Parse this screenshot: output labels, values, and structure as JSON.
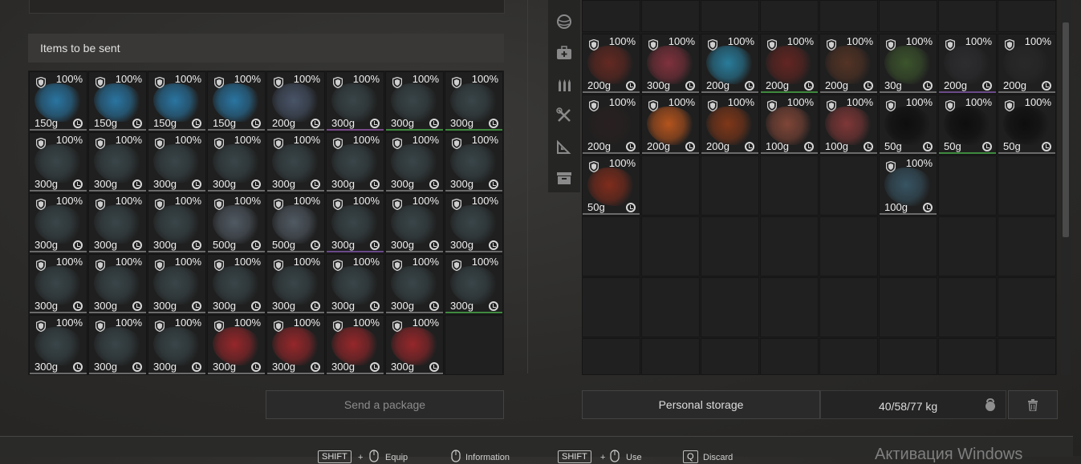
{
  "panels": {
    "send_header": "Items to be sent",
    "send_button": "Send a package",
    "storage_button": "Personal storage",
    "weight": "40/58/77 kg"
  },
  "left_items": [
    {
      "pct": "100%",
      "weight": "150g",
      "color": "#2b7fb0",
      "line": "#6b6b6b"
    },
    {
      "pct": "100%",
      "weight": "150g",
      "color": "#2b7fb0",
      "line": "#6b6b6b"
    },
    {
      "pct": "100%",
      "weight": "150g",
      "color": "#2b7fb0",
      "line": "#6b6b6b"
    },
    {
      "pct": "100%",
      "weight": "150g",
      "color": "#2b7fb0",
      "line": "#6b6b6b"
    },
    {
      "pct": "100%",
      "weight": "200g",
      "color": "#4d5a70",
      "line": "#6b6b6b"
    },
    {
      "pct": "100%",
      "weight": "300g",
      "color": "#3c4a4e",
      "line": "#7a4a8a"
    },
    {
      "pct": "100%",
      "weight": "300g",
      "color": "#3c4a4e",
      "line": "#3f8a3f"
    },
    {
      "pct": "100%",
      "weight": "300g",
      "color": "#3c4a4e",
      "line": "#3f8a3f"
    },
    {
      "pct": "100%",
      "weight": "300g",
      "color": "#3c4a4e",
      "line": "#6b6b6b"
    },
    {
      "pct": "100%",
      "weight": "300g",
      "color": "#3c4a4e",
      "line": "#6b6b6b"
    },
    {
      "pct": "100%",
      "weight": "300g",
      "color": "#3c4a4e",
      "line": "#6b6b6b"
    },
    {
      "pct": "100%",
      "weight": "300g",
      "color": "#3c4a4e",
      "line": "#6b6b6b"
    },
    {
      "pct": "100%",
      "weight": "300g",
      "color": "#3c4a4e",
      "line": "#6b6b6b"
    },
    {
      "pct": "100%",
      "weight": "300g",
      "color": "#3c4a4e",
      "line": "#6b6b6b"
    },
    {
      "pct": "100%",
      "weight": "300g",
      "color": "#3c4a4e",
      "line": "#6b6b6b"
    },
    {
      "pct": "100%",
      "weight": "300g",
      "color": "#3c4a4e",
      "line": "#6b6b6b"
    },
    {
      "pct": "100%",
      "weight": "300g",
      "color": "#3c4a4e",
      "line": "#6b6b6b"
    },
    {
      "pct": "100%",
      "weight": "300g",
      "color": "#3c4a4e",
      "line": "#6b6b6b"
    },
    {
      "pct": "100%",
      "weight": "300g",
      "color": "#3c4a4e",
      "line": "#6b6b6b"
    },
    {
      "pct": "100%",
      "weight": "500g",
      "color": "#56606a",
      "line": "#6b6b6b"
    },
    {
      "pct": "100%",
      "weight": "500g",
      "color": "#56606a",
      "line": "#6b6b6b"
    },
    {
      "pct": "100%",
      "weight": "300g",
      "color": "#3c4a4e",
      "line": "#6a4a8a"
    },
    {
      "pct": "100%",
      "weight": "300g",
      "color": "#3c4a4e",
      "line": "#6b6b6b"
    },
    {
      "pct": "100%",
      "weight": "300g",
      "color": "#3c4a4e",
      "line": "#6b6b6b"
    },
    {
      "pct": "100%",
      "weight": "300g",
      "color": "#3c4a4e",
      "line": "#6b6b6b"
    },
    {
      "pct": "100%",
      "weight": "300g",
      "color": "#3c4a4e",
      "line": "#6b6b6b"
    },
    {
      "pct": "100%",
      "weight": "300g",
      "color": "#3c4a4e",
      "line": "#6b6b6b"
    },
    {
      "pct": "100%",
      "weight": "300g",
      "color": "#3c4a4e",
      "line": "#6b6b6b"
    },
    {
      "pct": "100%",
      "weight": "300g",
      "color": "#3c4a4e",
      "line": "#6b6b6b"
    },
    {
      "pct": "100%",
      "weight": "300g",
      "color": "#3c4a4e",
      "line": "#6b6b6b"
    },
    {
      "pct": "100%",
      "weight": "300g",
      "color": "#3c4a4e",
      "line": "#6b6b6b"
    },
    {
      "pct": "100%",
      "weight": "300g",
      "color": "#3c4a4e",
      "line": "#3f8a3f"
    },
    {
      "pct": "100%",
      "weight": "300g",
      "color": "#3c4a4e",
      "line": "#6b6b6b"
    },
    {
      "pct": "100%",
      "weight": "300g",
      "color": "#3c4a4e",
      "line": "#6b6b6b"
    },
    {
      "pct": "100%",
      "weight": "300g",
      "color": "#3c4a4e",
      "line": "#6b6b6b"
    },
    {
      "pct": "100%",
      "weight": "300g",
      "color": "#a3282c",
      "line": "#6b6b6b"
    },
    {
      "pct": "100%",
      "weight": "300g",
      "color": "#a3282c",
      "line": "#6b6b6b"
    },
    {
      "pct": "100%",
      "weight": "300g",
      "color": "#a3282c",
      "line": "#6b6b6b"
    },
    {
      "pct": "100%",
      "weight": "300g",
      "color": "#a3282c",
      "line": "#6b6b6b"
    }
  ],
  "right_items": [
    {
      "pct": "100%",
      "weight": "200g",
      "color": "#6b2a22",
      "line": "#6b6b6b"
    },
    {
      "pct": "100%",
      "weight": "300g",
      "color": "#8a3440",
      "line": "#6b6b6b"
    },
    {
      "pct": "100%",
      "weight": "200g",
      "color": "#2a86a8",
      "line": "#6b6b6b"
    },
    {
      "pct": "100%",
      "weight": "200g",
      "color": "#6a2622",
      "line": "#3f8a3f"
    },
    {
      "pct": "100%",
      "weight": "200g",
      "color": "#5a3626",
      "line": "#6b6b6b"
    },
    {
      "pct": "100%",
      "weight": "30g",
      "color": "#3f5a2e",
      "line": "#6b6b6b"
    },
    {
      "pct": "100%",
      "weight": "200g",
      "color": "#2f2f33",
      "line": "#6a4a8a"
    },
    {
      "pct": "100%",
      "weight": "200g",
      "color": "#2a2a2a",
      "line": "#6b6b6b"
    },
    {
      "pct": "100%",
      "weight": "200g",
      "color": "#2a2020",
      "line": "#6b6b6b"
    },
    {
      "pct": "100%",
      "weight": "200g",
      "color": "#c55a1e",
      "line": "#6b6b6b"
    },
    {
      "pct": "100%",
      "weight": "200g",
      "color": "#8a3a18",
      "line": "#6b6b6b"
    },
    {
      "pct": "100%",
      "weight": "100g",
      "color": "#8a4a3a",
      "line": "#6b6b6b"
    },
    {
      "pct": "100%",
      "weight": "100g",
      "color": "#8a3a3a",
      "line": "#6b6b6b"
    },
    {
      "pct": "100%",
      "weight": "50g",
      "color": "#0c0c0c",
      "line": "#6b6b6b"
    },
    {
      "pct": "100%",
      "weight": "50g",
      "color": "#0c0c0c",
      "line": "#3f8a3f"
    },
    {
      "pct": "100%",
      "weight": "50g",
      "color": "#0c0c0c",
      "line": "#6b6b6b"
    },
    {
      "pct": "100%",
      "weight": "50g",
      "color": "#8a2e1c",
      "line": "#6b6b6b"
    },
    {
      "pct": "100%",
      "weight": "100g",
      "color": "#3a5a6a",
      "line": "#6b6b6b"
    }
  ],
  "hints": {
    "shift1": "SHIFT",
    "equip": "Equip",
    "information": "Information",
    "shift2": "SHIFT",
    "use": "Use",
    "key_q": "Q",
    "discard": "Discard"
  },
  "watermark": "Активация Windows",
  "icons": [
    "shield-icon",
    "clock-icon",
    "globe-tab-icon",
    "medkit-tab-icon",
    "ammo-tab-icon",
    "tools-tab-icon",
    "blueprint-tab-icon",
    "box-tab-icon",
    "kettlebell-icon",
    "trash-icon",
    "mouse-icon"
  ]
}
